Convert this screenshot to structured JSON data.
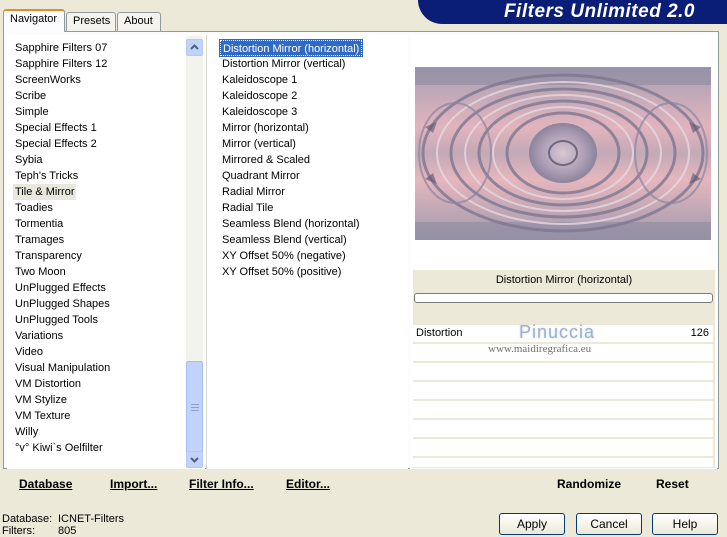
{
  "tabs": [
    {
      "label": "Navigator",
      "active": true
    },
    {
      "label": "Presets",
      "active": false
    },
    {
      "label": "About",
      "active": false
    }
  ],
  "app_title": "Filters Unlimited 2.0",
  "categories": [
    "Sapphire Filters 07",
    "Sapphire Filters 12",
    "ScreenWorks",
    "Scribe",
    "Simple",
    "Special Effects 1",
    "Special Effects 2",
    "Sybia",
    "Teph's Tricks",
    "Tile & Mirror",
    "Toadies",
    "Tormentia",
    "Tramages",
    "Transparency",
    "Two Moon",
    "UnPlugged Effects",
    "UnPlugged Shapes",
    "UnPlugged Tools",
    "Variations",
    "Video",
    "Visual Manipulation",
    "VM Distortion",
    "VM Stylize",
    "VM Texture",
    "Willy",
    "°v° Kiwi`s Oelfilter"
  ],
  "selected_category": "Tile & Mirror",
  "filters": [
    "Distortion Mirror (horizontal)",
    "Distortion Mirror (vertical)",
    "Kaleidoscope 1",
    "Kaleidoscope 2",
    "Kaleidoscope 3",
    "Mirror (horizontal)",
    "Mirror (vertical)",
    "Mirrored & Scaled",
    "Quadrant Mirror",
    "Radial Mirror",
    "Radial Tile",
    "Seamless Blend (horizontal)",
    "Seamless Blend (vertical)",
    "XY Offset 50% (negative)",
    "XY Offset 50% (positive)"
  ],
  "selected_filter": "Distortion Mirror (horizontal)",
  "preview": {
    "filter_name": "Distortion Mirror (horizontal)",
    "watermark_name": "Pinuccia",
    "watermark_url": "www.maidiregrafica.eu"
  },
  "parameters": [
    {
      "name": "Distortion",
      "value": "126"
    }
  ],
  "bottom_links": {
    "database": "Database",
    "import": "Import...",
    "filter_info": "Filter Info...",
    "editor": "Editor...",
    "randomize": "Randomize",
    "reset": "Reset"
  },
  "status": {
    "database_label": "Database:",
    "database_value": "ICNET-Filters",
    "filters_label": "Filters:",
    "filters_value": "805"
  },
  "buttons": {
    "apply": "Apply",
    "cancel": "Cancel",
    "help": "Help"
  },
  "colors": {
    "selection": "#316ac5",
    "banner": "#0a1e78",
    "active_tab_accent": "#e68b2c"
  },
  "icons": {
    "scroll_up": "chevron-up-icon",
    "scroll_down": "chevron-down-icon"
  }
}
